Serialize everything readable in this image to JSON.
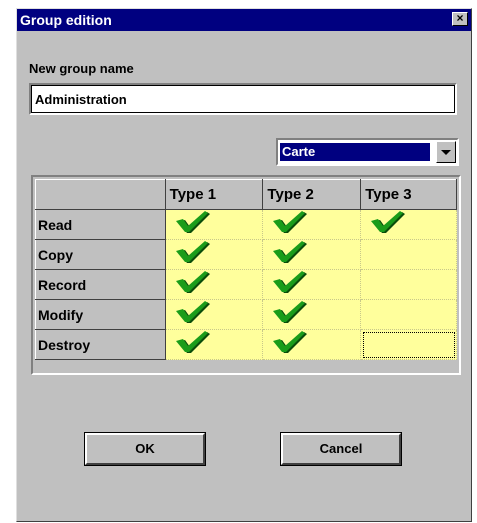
{
  "window": {
    "title": "Group edition",
    "close_glyph": "×"
  },
  "form": {
    "label": "New group name",
    "group_name": "Administration"
  },
  "select": {
    "value": "Carte"
  },
  "grid": {
    "columns": [
      "",
      "Type 1",
      "Type 2",
      "Type 3"
    ],
    "rows": [
      {
        "label": "Read",
        "checks": [
          true,
          true,
          true
        ]
      },
      {
        "label": "Copy",
        "checks": [
          true,
          true,
          false
        ]
      },
      {
        "label": "Record",
        "checks": [
          true,
          true,
          false
        ]
      },
      {
        "label": "Modify",
        "checks": [
          true,
          true,
          false
        ]
      },
      {
        "label": "Destroy",
        "checks": [
          true,
          true,
          false
        ]
      }
    ],
    "check_icon": "checkmark-icon"
  },
  "buttons": {
    "ok": "OK",
    "cancel": "Cancel"
  },
  "colors": {
    "titlebar": "#000080",
    "cell_bg": "#ffff9c",
    "check_green": "#1a9c1a",
    "face": "#c0c0c0"
  }
}
